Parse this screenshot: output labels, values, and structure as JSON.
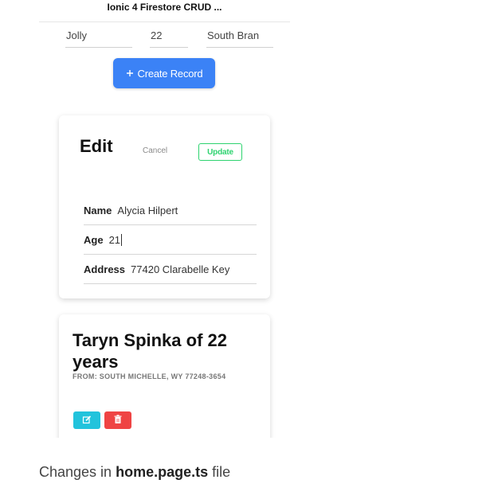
{
  "app": {
    "title": "Ionic 4 Firestore CRUD ..."
  },
  "create_form": {
    "name_value": "Jolly",
    "age_value": "22",
    "address_value": "South Bran",
    "create_icon": "plus-icon",
    "create_label": "Create Record",
    "button_color": "#3b82f6"
  },
  "edit_card": {
    "title": "Edit",
    "cancel_label": "Cancel",
    "update_label": "Update",
    "fields": [
      {
        "label": "Name",
        "value": "Alycia Hilpert"
      },
      {
        "label": "Age",
        "value": "21"
      },
      {
        "label": "Address",
        "value": "77420 Clarabelle Key"
      }
    ],
    "update_color": "#2dd36f"
  },
  "record_card": {
    "title": "Taryn Spinka of 22 years",
    "from_text": "FROM: SOUTH MICHELLE, WY 77248-3654",
    "edit_icon": "edit-icon",
    "delete_icon": "trash-icon",
    "edit_color": "#22c3dc",
    "delete_color": "#ef4444"
  },
  "caption": {
    "prefix": "Changes in",
    "filename": "home.page.ts",
    "suffix": "file"
  }
}
